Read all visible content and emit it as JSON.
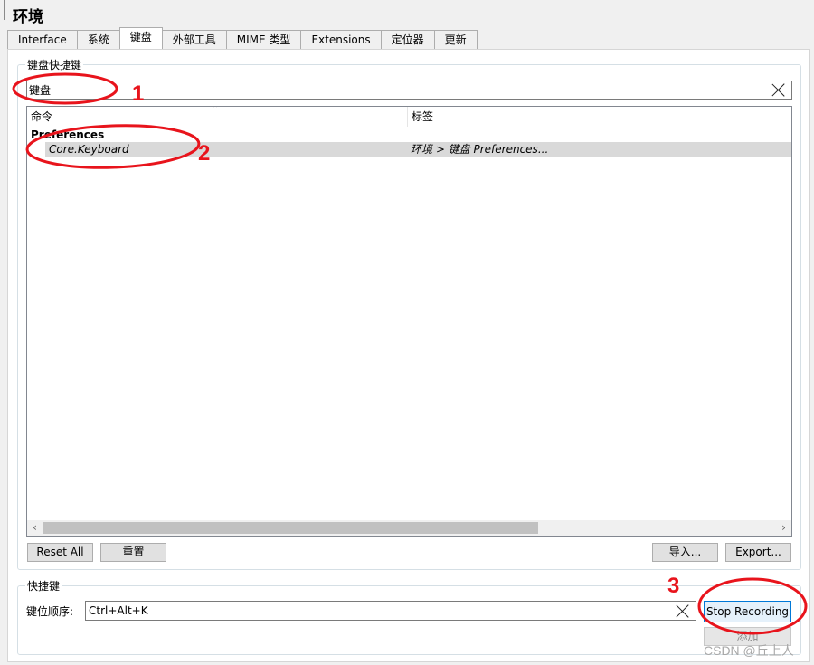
{
  "window": {
    "title": "环境"
  },
  "tabs": [
    {
      "label": "Interface",
      "active": false
    },
    {
      "label": "系统",
      "active": false
    },
    {
      "label": "键盘",
      "active": true
    },
    {
      "label": "外部工具",
      "active": false
    },
    {
      "label": "MIME 类型",
      "active": false
    },
    {
      "label": "Extensions",
      "active": false
    },
    {
      "label": "定位器",
      "active": false
    },
    {
      "label": "更新",
      "active": false
    }
  ],
  "shortcuts_group": {
    "label": "键盘快捷键",
    "search_value": "键盘",
    "columns": {
      "command": "命令",
      "label": "标签"
    },
    "category": "Preferences",
    "rows": [
      {
        "command": "Core.Keyboard",
        "label": "环境 > 键盘 Preferences..."
      }
    ],
    "buttons": {
      "reset_all": "Reset All",
      "reset": "重置",
      "import": "导入...",
      "export": "Export..."
    }
  },
  "shortcut_group": {
    "label": "快捷键",
    "sequence_label": "键位顺序:",
    "sequence_value": "Ctrl+Alt+K",
    "stop_recording": "Stop Recording",
    "add": "添加"
  },
  "annotations": {
    "marker_1": "1",
    "marker_2": "2",
    "marker_3": "3",
    "color": "#e8141c"
  },
  "watermark": "CSDN @丘上人",
  "colors": {
    "selection": "#d9d9d9",
    "accent": "#0078d7",
    "panel": "#ffffff",
    "background": "#f0f0f0"
  },
  "icons": {
    "clear": "close-x-icon",
    "sort": "sort-ascending-icon",
    "scroll_left": "chevron-left-icon",
    "scroll_right": "chevron-right-icon"
  }
}
